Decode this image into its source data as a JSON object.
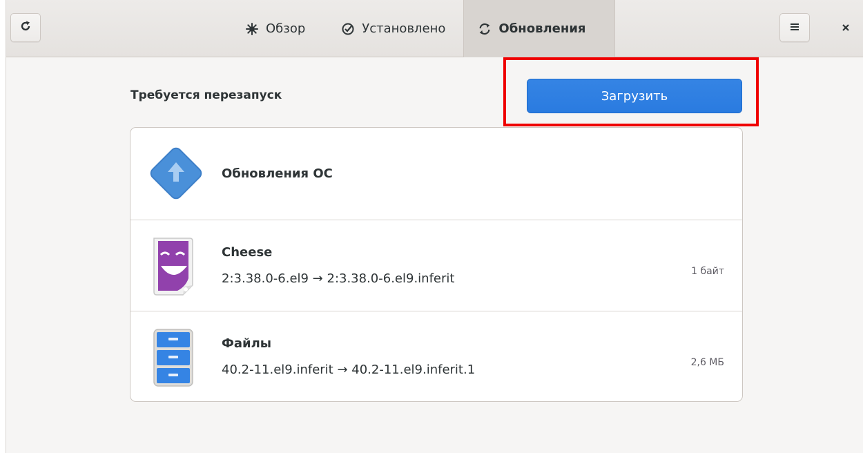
{
  "header": {
    "refresh_icon": "refresh-icon",
    "menu_icon": "hamburger-menu-icon",
    "close_icon": "close-icon",
    "tabs": [
      {
        "label": "Обзор",
        "icon": "explore-icon",
        "active": false
      },
      {
        "label": "Установлено",
        "icon": "check-circle-icon",
        "active": false
      },
      {
        "label": "Обновления",
        "icon": "updates-icon",
        "active": true
      }
    ]
  },
  "main": {
    "section_title": "Требуется перезапуск",
    "download_label": "Загрузить",
    "updates": [
      {
        "name": "Обновления ОС",
        "icon": "os-update-icon"
      },
      {
        "name": "Cheese",
        "icon": "cheese-app-icon",
        "version": "2:3.38.0-6.el9 → 2:3.38.0-6.el9.inferit",
        "size": "1 байт"
      },
      {
        "name": "Файлы",
        "icon": "files-app-icon",
        "version": "40.2-11.el9.inferit → 40.2-11.el9.inferit.1",
        "size": "2,6 МБ"
      }
    ]
  },
  "colors": {
    "accent": "#3584e4",
    "highlight": "#ef0000",
    "headerbar": "#e8e6e3"
  }
}
